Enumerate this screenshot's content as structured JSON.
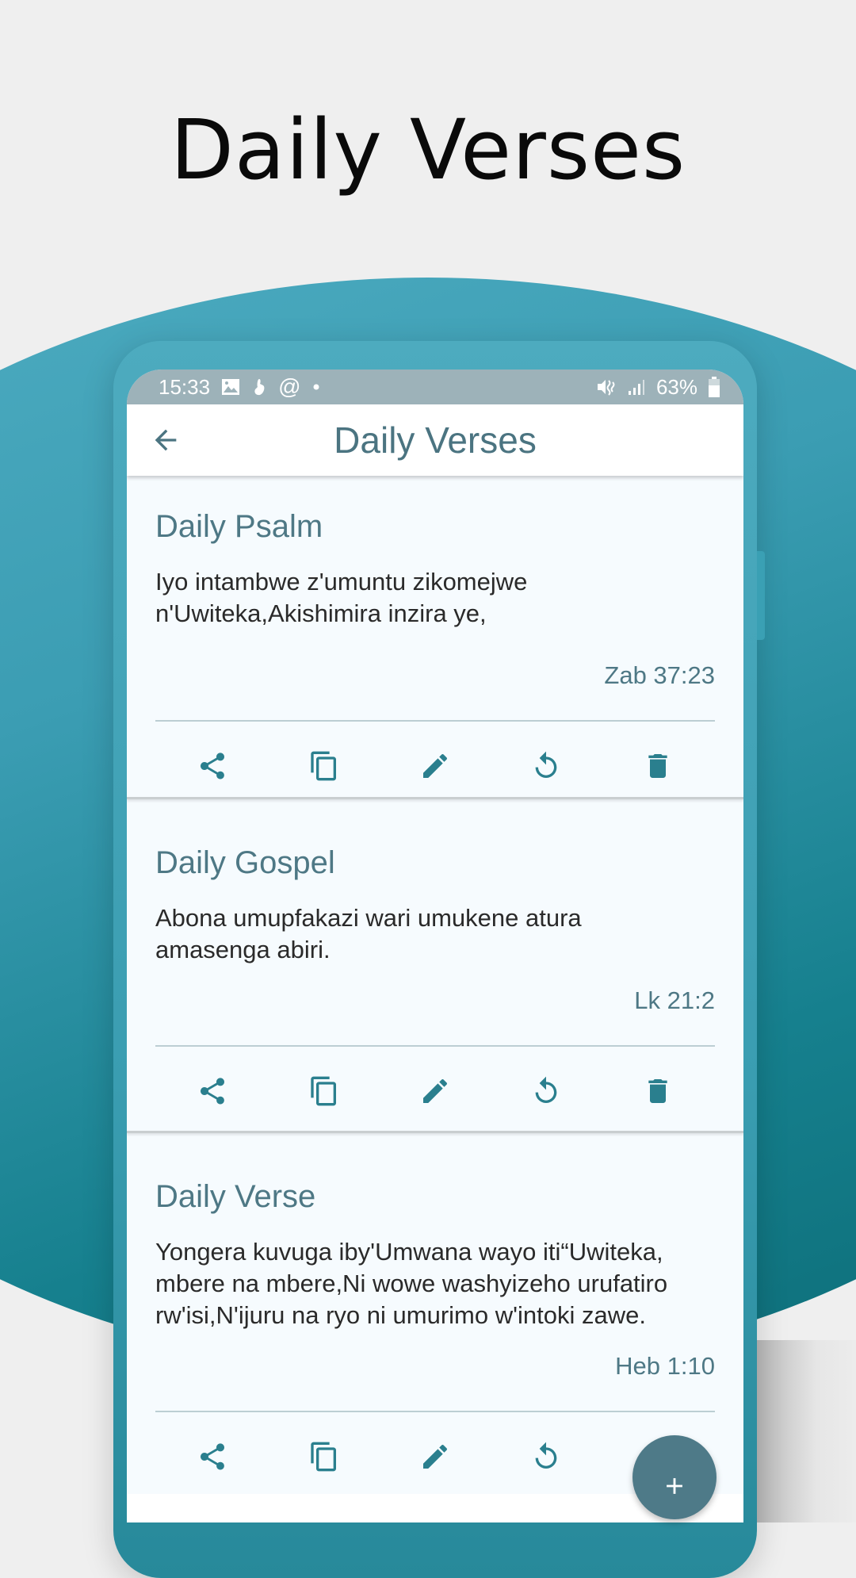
{
  "promo": {
    "title": "Daily Verses"
  },
  "status_bar": {
    "time": "15:33",
    "left_icons": [
      "gallery-icon",
      "hand-icon",
      "at-icon",
      "dot-icon"
    ],
    "right_icons": [
      "mute-vibrate-icon",
      "signal-icon"
    ],
    "battery_percent": "63%"
  },
  "app_bar": {
    "title": "Daily Verses",
    "back_icon": "arrow-left-icon"
  },
  "cards": [
    {
      "title": "Daily Psalm",
      "body": "Iyo intambwe z'umuntu zikomejwe n'Uwiteka,Akishimira inzira ye,",
      "reference": "Zab 37:23",
      "actions": [
        "share",
        "copy",
        "edit",
        "refresh",
        "delete"
      ]
    },
    {
      "title": "Daily Gospel",
      "body": "Abona umupfakazi wari umukene atura amasenga abiri.",
      "reference": "Lk 21:2",
      "actions": [
        "share",
        "copy",
        "edit",
        "refresh",
        "delete"
      ]
    },
    {
      "title": "Daily Verse",
      "body": "Yongera kuvuga iby'Umwana wayo iti“Uwiteka, mbere na mbere,Ni wowe washyizeho urufatiro rw'isi,N'ijuru na ryo ni umurimo w'intoki zawe.",
      "reference": "Heb 1:10",
      "actions": [
        "share",
        "copy",
        "edit",
        "refresh"
      ]
    }
  ],
  "fab": {
    "icon": "plus-icon"
  },
  "colors": {
    "accent": "#4e7885",
    "icon": "#2a7f8e",
    "teal_background": "#3b9db3",
    "status_bar": "#9db2b9",
    "fab": "#4e7a88"
  }
}
